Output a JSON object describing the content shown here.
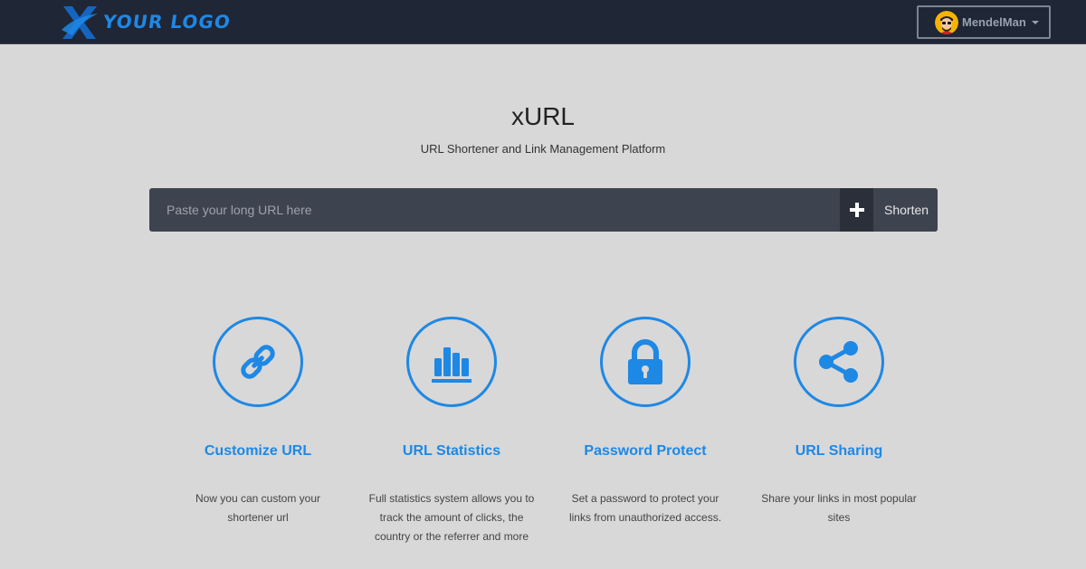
{
  "navbar": {
    "logo_text": "YOUR LOGO",
    "user_name": "MendelMan"
  },
  "hero": {
    "title": "xURL",
    "subtitle": "URL Shortener and Link Management Platform"
  },
  "shorten": {
    "placeholder": "Paste your long URL here",
    "button_label": "Shorten"
  },
  "features": [
    {
      "icon": "link-icon",
      "title": "Customize URL",
      "description": "Now you can custom your shortener url"
    },
    {
      "icon": "bar-chart-icon",
      "title": "URL Statistics",
      "description": "Full statistics system allows you to track the amount of clicks, the country or the referrer and more"
    },
    {
      "icon": "lock-icon",
      "title": "Password Protect",
      "description": "Set a password to protect your links from unauthorized access."
    },
    {
      "icon": "share-icon",
      "title": "URL Sharing",
      "description": "Share your links in most popular sites"
    }
  ],
  "colors": {
    "accent": "#1e88e5",
    "navbar_bg": "#1f2636",
    "page_bg": "#d8d8d8",
    "input_bg": "#3e4350"
  }
}
